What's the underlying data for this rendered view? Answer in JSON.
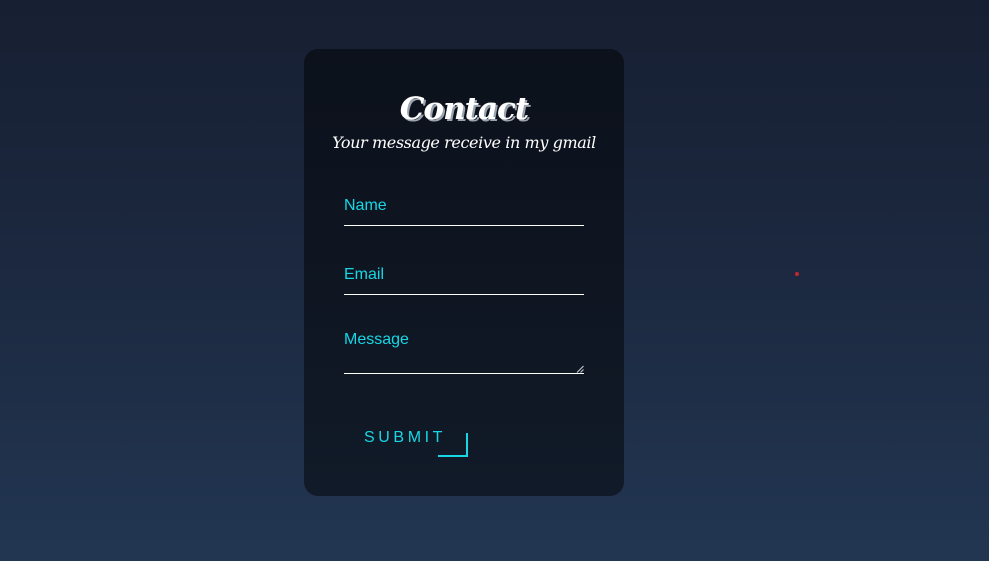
{
  "contact_card": {
    "title": "Contact",
    "subtitle": "Your message receive in my gmail",
    "fields": {
      "name_label": "Name",
      "email_label": "Email",
      "message_label": "Message"
    },
    "submit_label": "SUBMIT"
  },
  "colors": {
    "accent": "#17d7e6",
    "card_background": "#0e1521",
    "page_background": "#1c2940",
    "dot": "#c0282d"
  },
  "icons": {
    "resize_handle": "textarea-resize-icon"
  }
}
